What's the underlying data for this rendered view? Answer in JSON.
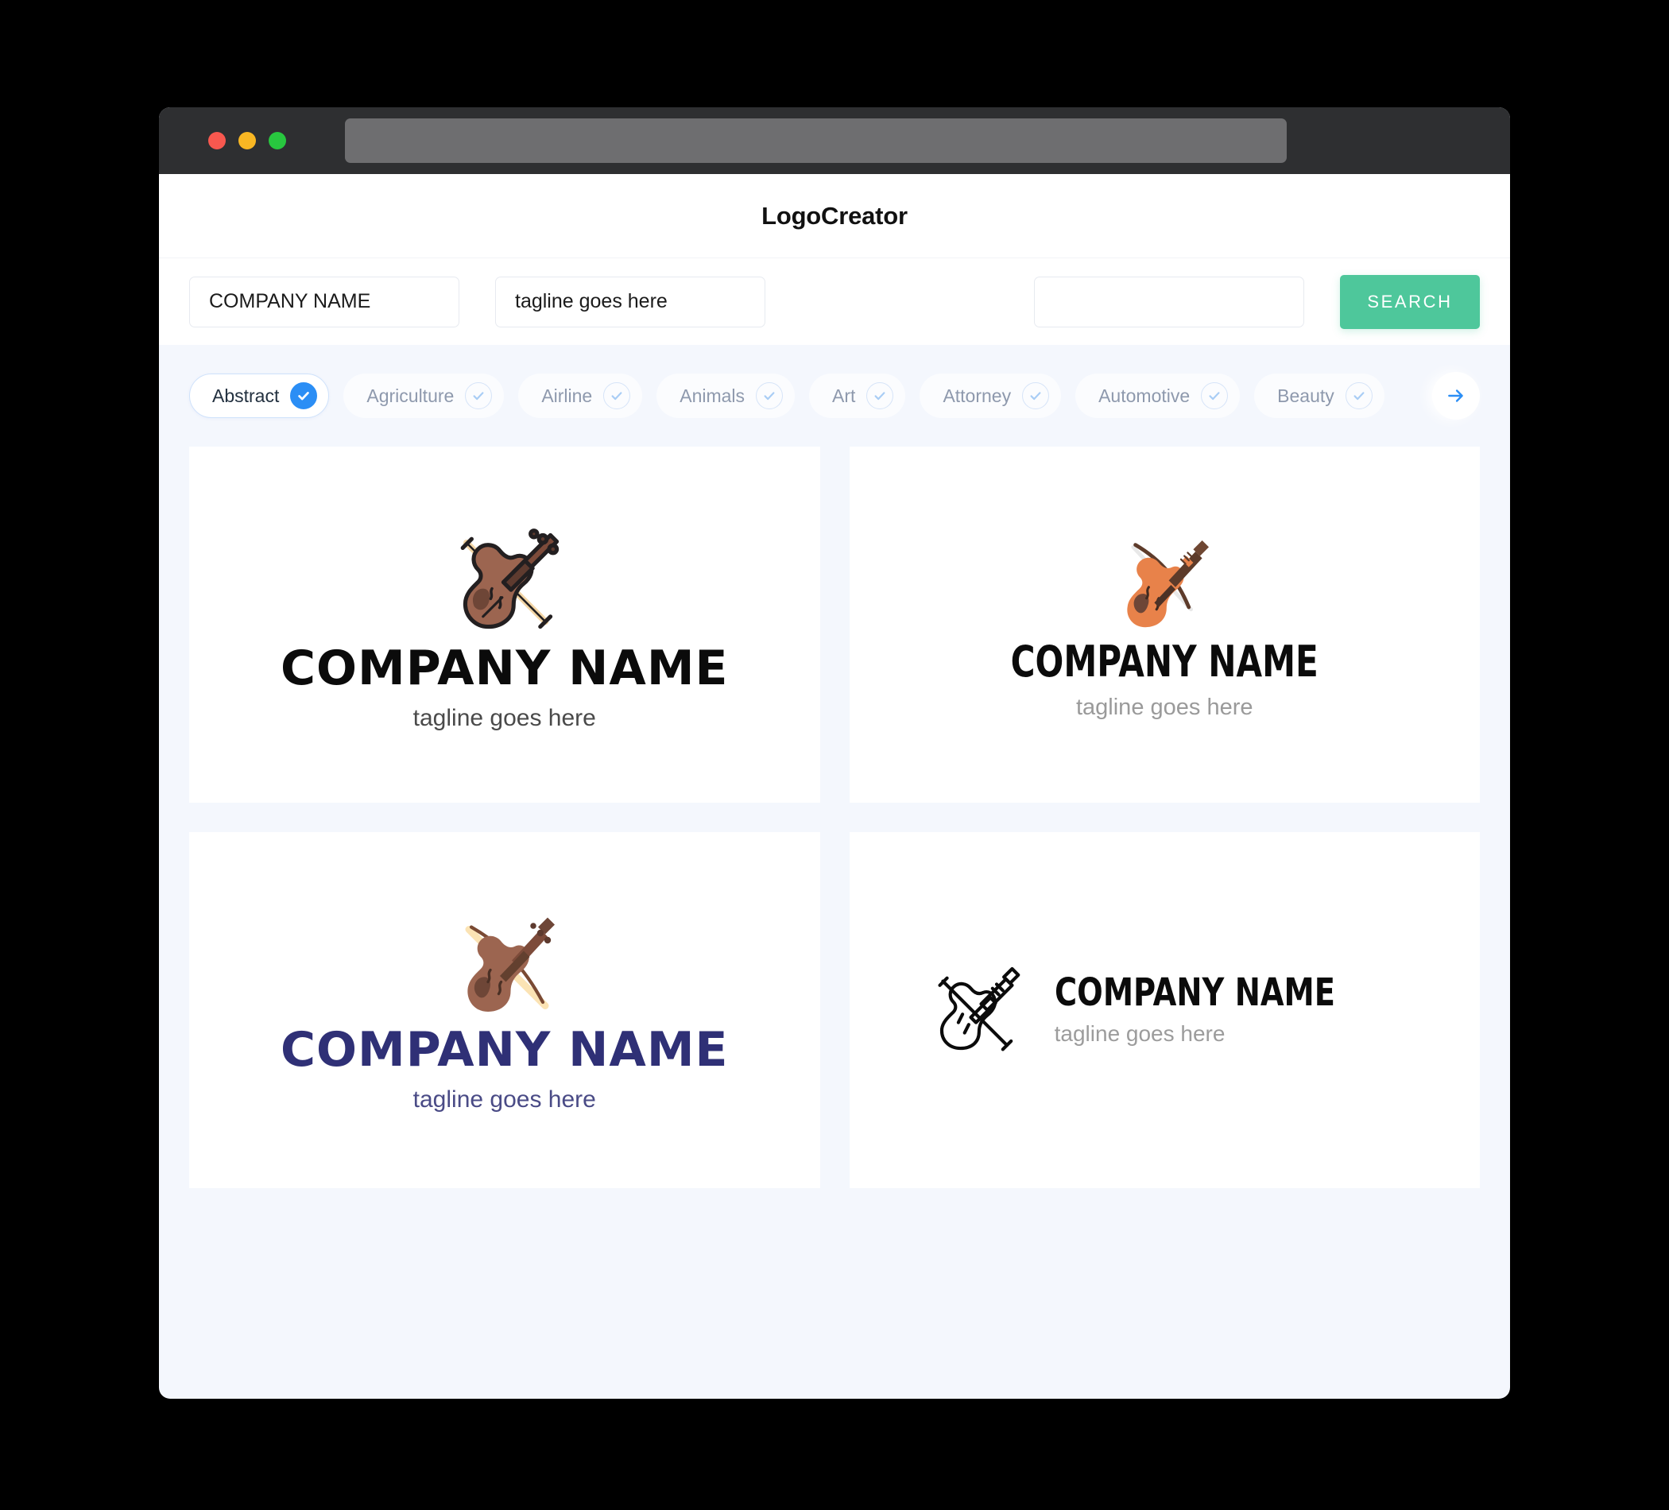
{
  "window": {
    "traffic_lights": [
      "close",
      "minimize",
      "maximize"
    ],
    "url_bar_value": ""
  },
  "header": {
    "title": "LogoCreator"
  },
  "search": {
    "company_value": "COMPANY NAME",
    "company_placeholder": "COMPANY NAME",
    "tagline_value": "tagline goes here",
    "tagline_placeholder": "tagline goes here",
    "third_value": "",
    "third_placeholder": "",
    "search_button_label": "SEARCH",
    "search_button_color": "#4ec79b"
  },
  "categories": {
    "accent_color": "#2b8ef5",
    "next_arrow_icon": "arrow-right-icon",
    "items": [
      {
        "label": "Abstract",
        "selected": true
      },
      {
        "label": "Agriculture",
        "selected": false
      },
      {
        "label": "Airline",
        "selected": false
      },
      {
        "label": "Animals",
        "selected": false
      },
      {
        "label": "Art",
        "selected": false
      },
      {
        "label": "Attorney",
        "selected": false
      },
      {
        "label": "Automotive",
        "selected": false
      },
      {
        "label": "Beauty",
        "selected": false
      }
    ]
  },
  "results": {
    "cards": [
      {
        "icon": "violin-outlined-brown-icon",
        "company_name": "COMPANY NAME",
        "tagline": "tagline goes here",
        "layout": "stacked",
        "name_color": "#0b0b0b",
        "tagline_color": "#4a4a4a"
      },
      {
        "icon": "violin-flat-orange-icon",
        "company_name": "COMPANY NAME",
        "tagline": "tagline goes here",
        "layout": "stacked",
        "name_color": "#0b0b0b",
        "tagline_color": "#9a9a9a"
      },
      {
        "icon": "violin-flat-brown-icon",
        "company_name": "COMPANY NAME",
        "tagline": "tagline goes here",
        "layout": "stacked",
        "name_color": "#2f3076",
        "tagline_color": "#4a4b86"
      },
      {
        "icon": "violin-lineart-black-icon",
        "company_name": "COMPANY NAME",
        "tagline": "tagline goes here",
        "layout": "horizontal",
        "name_color": "#0b0b0b",
        "tagline_color": "#9c9c9c"
      }
    ]
  }
}
